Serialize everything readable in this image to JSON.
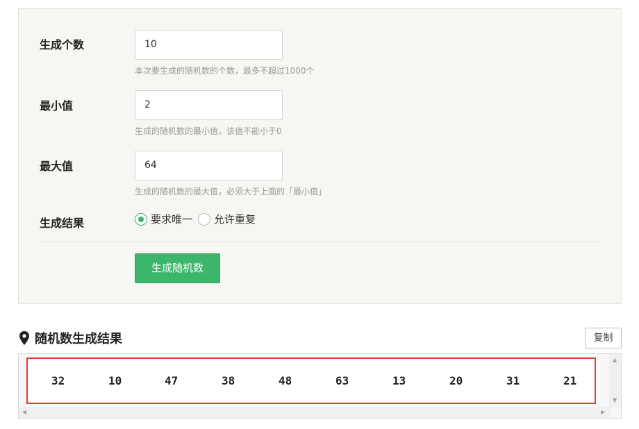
{
  "form": {
    "count": {
      "label": "生成个数",
      "value": "10",
      "help": "本次要生成的随机数的个数，最多不超过1000个"
    },
    "min": {
      "label": "最小值",
      "value": "2",
      "help": "生成的随机数的最小值，该值不能小于0"
    },
    "max": {
      "label": "最大值",
      "value": "64",
      "help": "生成的随机数的最大值，必须大于上面的「最小值」"
    },
    "result_mode": {
      "label": "生成结果",
      "options": [
        "要求唯一",
        "允许重复"
      ],
      "selected": "要求唯一"
    },
    "generate_button": "生成随机数"
  },
  "results": {
    "title": "随机数生成结果",
    "copy_button": "复制",
    "numbers": [
      "32",
      "10",
      "47",
      "38",
      "48",
      "63",
      "13",
      "20",
      "31",
      "21"
    ]
  },
  "colors": {
    "accent_green": "#3cb66b",
    "highlight_red": "#e03b3b",
    "panel_bg": "#f6f6f2"
  }
}
